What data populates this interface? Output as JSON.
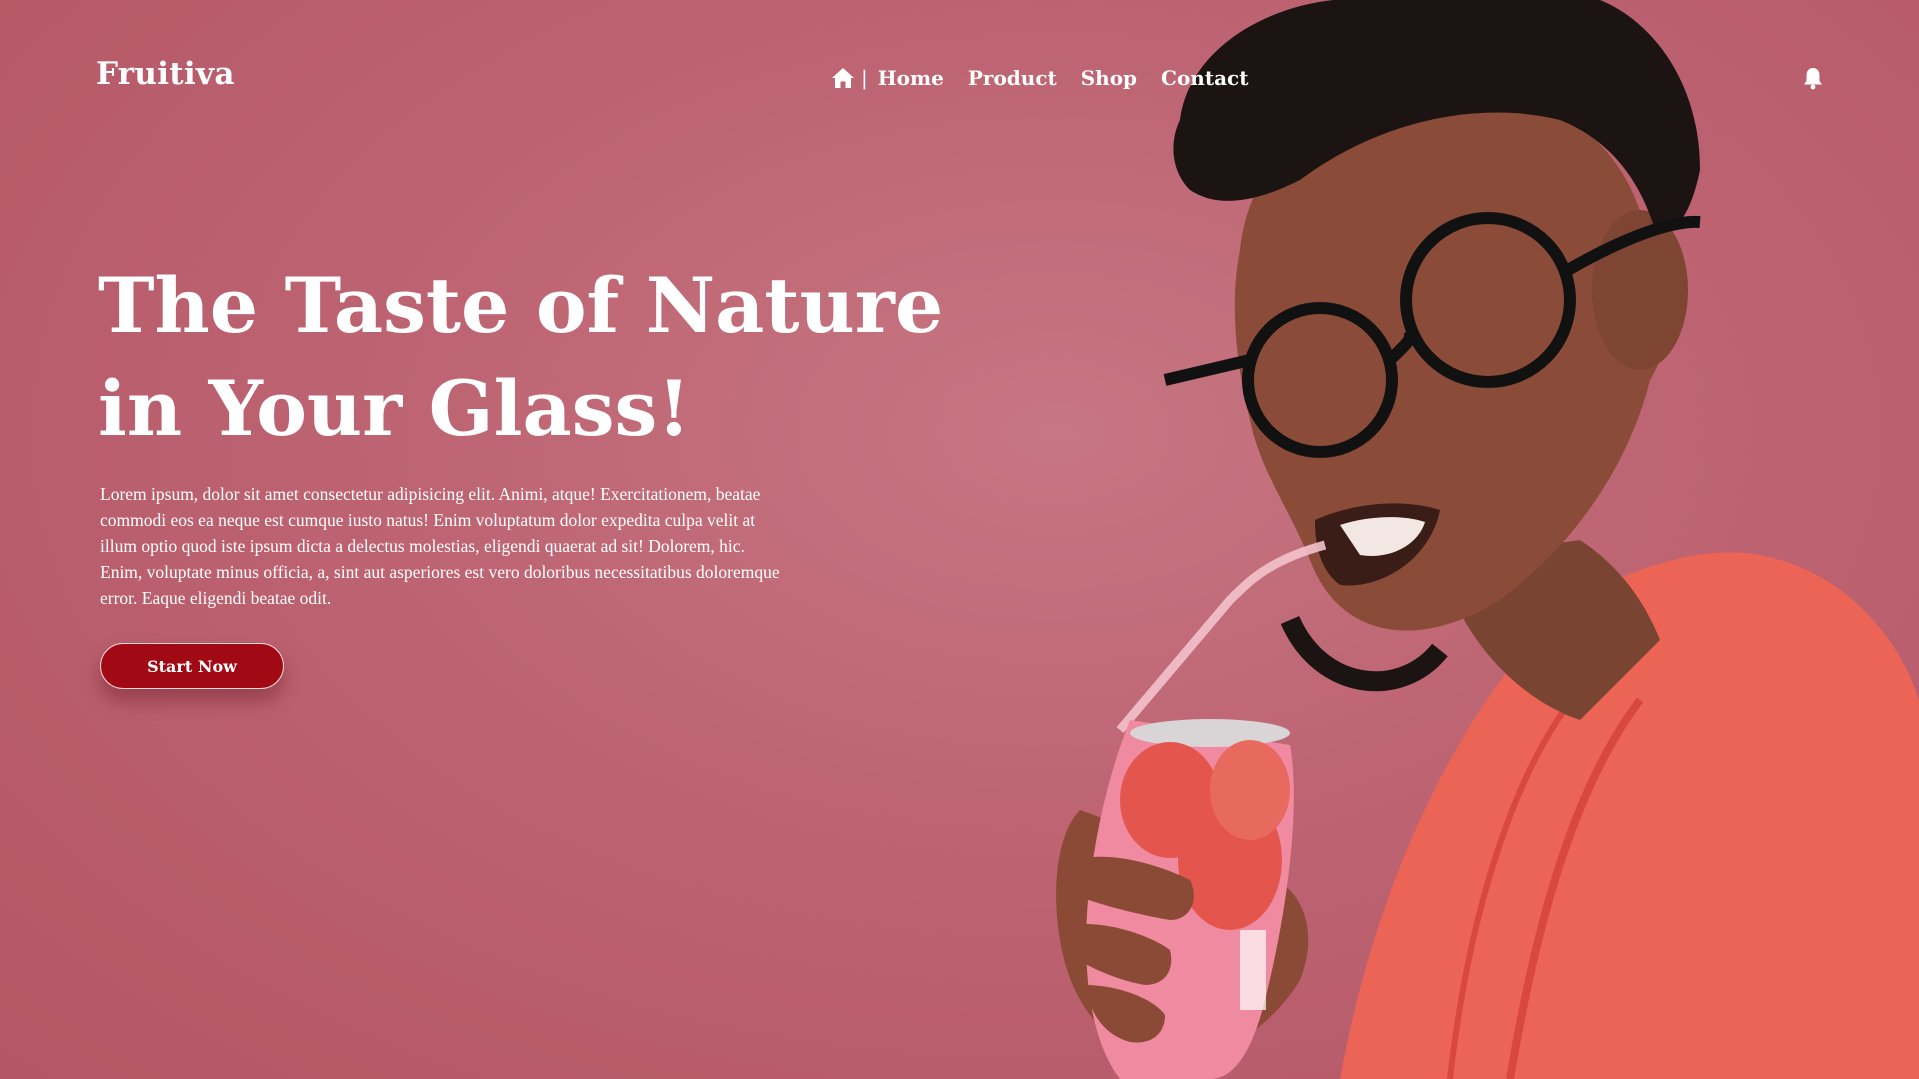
{
  "brand": {
    "name": "Fruitiva"
  },
  "nav": {
    "home_icon": "home-icon",
    "separator": "|",
    "items": [
      {
        "label": "Home"
      },
      {
        "label": "Product"
      },
      {
        "label": "Shop"
      },
      {
        "label": "Contact"
      }
    ],
    "notification_icon": "bell-icon"
  },
  "hero": {
    "headline_line1": "The Taste of Nature",
    "headline_line2": "in Your Glass!",
    "description": "Lorem ipsum, dolor sit amet consectetur adipisicing elit. Animi, atque! Exercitationem, beatae commodi eos ea neque est cumque iusto natus! Enim voluptatum dolor expedita culpa velit at illum optio quod iste ipsum dicta a delectus molestias, eligendi quaerat ad sit! Dolorem, hic. Enim, voluptate minus officia, a, sint aut asperiores est vero doloribus necessitatibus doloremque error. Eaque eligendi beatae odit.",
    "cta_label": "Start Now"
  },
  "colors": {
    "background": "#bd6371",
    "cta": "#a10a14",
    "hoodie": "#f06a5e",
    "can": "#f08aa0"
  }
}
